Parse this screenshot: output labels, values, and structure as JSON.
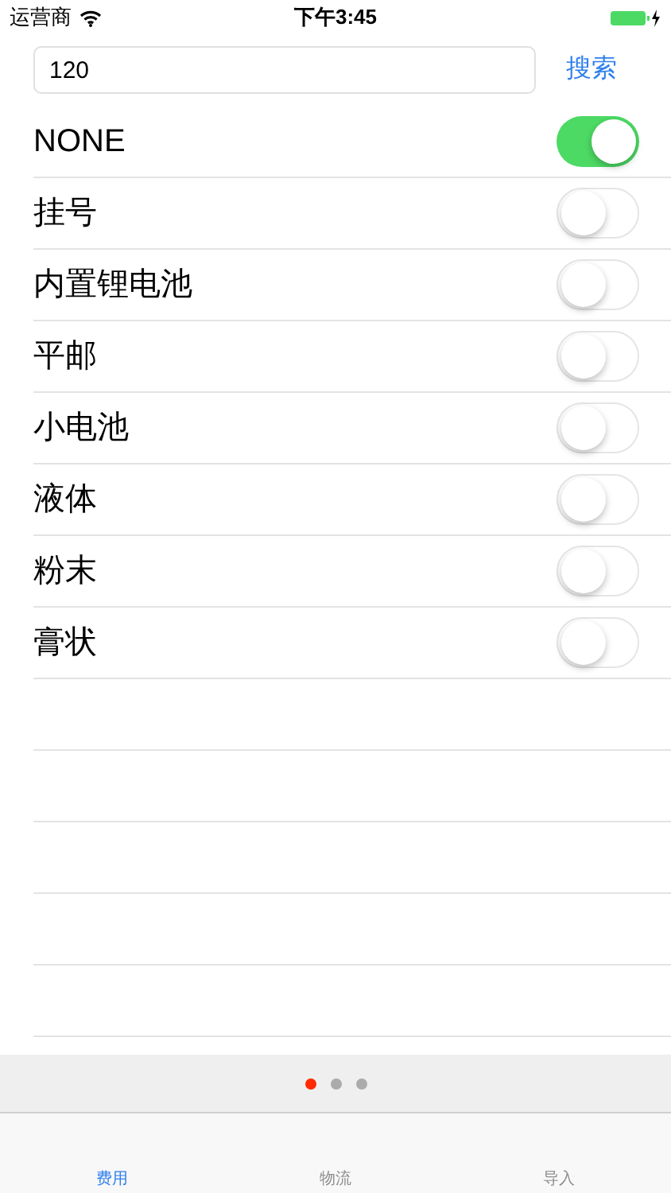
{
  "status_bar": {
    "carrier": "运营商",
    "time": "下午3:45"
  },
  "search": {
    "value": "120",
    "button": "搜索"
  },
  "options": [
    {
      "label": "NONE",
      "on": true
    },
    {
      "label": "挂号",
      "on": false
    },
    {
      "label": "内置锂电池",
      "on": false
    },
    {
      "label": "平邮",
      "on": false
    },
    {
      "label": "小电池",
      "on": false
    },
    {
      "label": "液体",
      "on": false
    },
    {
      "label": "粉末",
      "on": false
    },
    {
      "label": "膏状",
      "on": false
    }
  ],
  "page_dots": [
    {
      "selected": true
    },
    {
      "selected": false
    },
    {
      "selected": false
    }
  ],
  "tabs": [
    {
      "label": "费用",
      "selected": true
    },
    {
      "label": "物流",
      "selected": false
    },
    {
      "label": "导入",
      "selected": false
    }
  ]
}
